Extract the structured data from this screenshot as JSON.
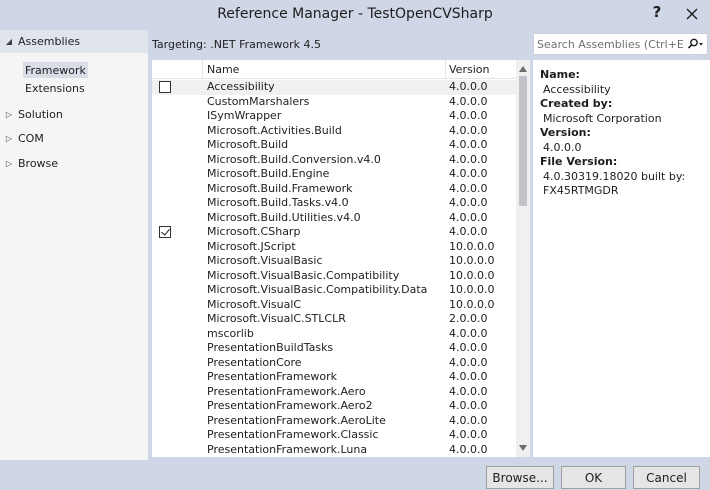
{
  "window": {
    "title": "Reference Manager - TestOpenCVSharp",
    "help_label": "?"
  },
  "nav": {
    "sections": [
      {
        "label": "Assemblies",
        "arrow": "◢",
        "active": true
      },
      {
        "label": "Solution",
        "arrow": "▷"
      },
      {
        "label": "COM",
        "arrow": "▷"
      },
      {
        "label": "Browse",
        "arrow": "▷"
      }
    ],
    "sub_items": [
      {
        "label": "Framework",
        "selected": true
      },
      {
        "label": "Extensions"
      }
    ]
  },
  "targeting": "Targeting: .NET Framework 4.5",
  "search": {
    "placeholder": "Search Assemblies (Ctrl+E)",
    "icon": "search-icon"
  },
  "list": {
    "columns": [
      "Name",
      "Version"
    ],
    "rows": [
      {
        "name": "Accessibility",
        "version": "4.0.0.0",
        "checked": false,
        "checkbox_visible": true
      },
      {
        "name": "CustomMarshalers",
        "version": "4.0.0.0"
      },
      {
        "name": "ISymWrapper",
        "version": "4.0.0.0"
      },
      {
        "name": "Microsoft.Activities.Build",
        "version": "4.0.0.0"
      },
      {
        "name": "Microsoft.Build",
        "version": "4.0.0.0"
      },
      {
        "name": "Microsoft.Build.Conversion.v4.0",
        "version": "4.0.0.0"
      },
      {
        "name": "Microsoft.Build.Engine",
        "version": "4.0.0.0"
      },
      {
        "name": "Microsoft.Build.Framework",
        "version": "4.0.0.0"
      },
      {
        "name": "Microsoft.Build.Tasks.v4.0",
        "version": "4.0.0.0"
      },
      {
        "name": "Microsoft.Build.Utilities.v4.0",
        "version": "4.0.0.0"
      },
      {
        "name": "Microsoft.CSharp",
        "version": "4.0.0.0",
        "checked": true,
        "checkbox_visible": true
      },
      {
        "name": "Microsoft.JScript",
        "version": "10.0.0.0"
      },
      {
        "name": "Microsoft.VisualBasic",
        "version": "10.0.0.0"
      },
      {
        "name": "Microsoft.VisualBasic.Compatibility",
        "version": "10.0.0.0"
      },
      {
        "name": "Microsoft.VisualBasic.Compatibility.Data",
        "version": "10.0.0.0"
      },
      {
        "name": "Microsoft.VisualC",
        "version": "10.0.0.0"
      },
      {
        "name": "Microsoft.VisualC.STLCLR",
        "version": "2.0.0.0"
      },
      {
        "name": "mscorlib",
        "version": "4.0.0.0"
      },
      {
        "name": "PresentationBuildTasks",
        "version": "4.0.0.0"
      },
      {
        "name": "PresentationCore",
        "version": "4.0.0.0"
      },
      {
        "name": "PresentationFramework",
        "version": "4.0.0.0"
      },
      {
        "name": "PresentationFramework.Aero",
        "version": "4.0.0.0"
      },
      {
        "name": "PresentationFramework.Aero2",
        "version": "4.0.0.0"
      },
      {
        "name": "PresentationFramework.AeroLite",
        "version": "4.0.0.0"
      },
      {
        "name": "PresentationFramework.Classic",
        "version": "4.0.0.0"
      },
      {
        "name": "PresentationFramework.Luna",
        "version": "4.0.0.0"
      }
    ]
  },
  "details": [
    {
      "label": "Name:",
      "value": "Accessibility"
    },
    {
      "label": "Created by:",
      "value": "Microsoft Corporation"
    },
    {
      "label": "Version:",
      "value": "4.0.0.0"
    },
    {
      "label": "File Version:",
      "value": "4.0.30319.18020 built by:",
      "value2": "FX45RTMGDR"
    }
  ],
  "buttons": {
    "browse": "Browse...",
    "ok": "OK",
    "cancel": "Cancel"
  },
  "colors": {
    "chrome": "#cfd6e5",
    "panel": "#ffffff",
    "nav_active": "#e0e4ec"
  }
}
